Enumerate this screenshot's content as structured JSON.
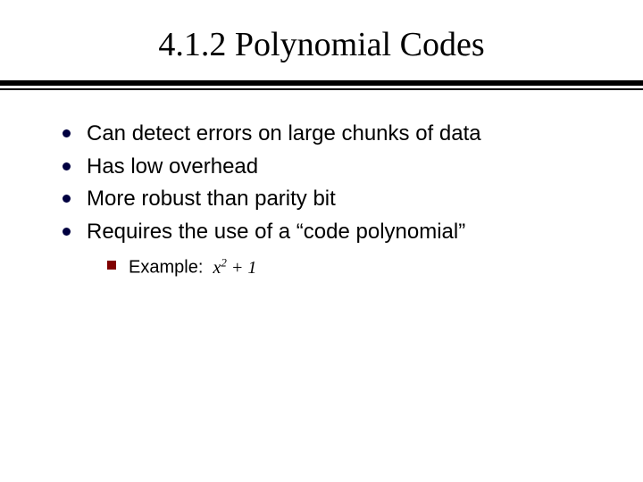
{
  "title": "4.1.2 Polynomial Codes",
  "bullets": [
    "Can detect errors on large chunks of data",
    "Has low overhead",
    "More robust than parity bit",
    "Requires the use of a “code polynomial”"
  ],
  "sub": {
    "label": "Example:",
    "expr_base": "x",
    "expr_sup": "2",
    "expr_tail": " + 1"
  }
}
